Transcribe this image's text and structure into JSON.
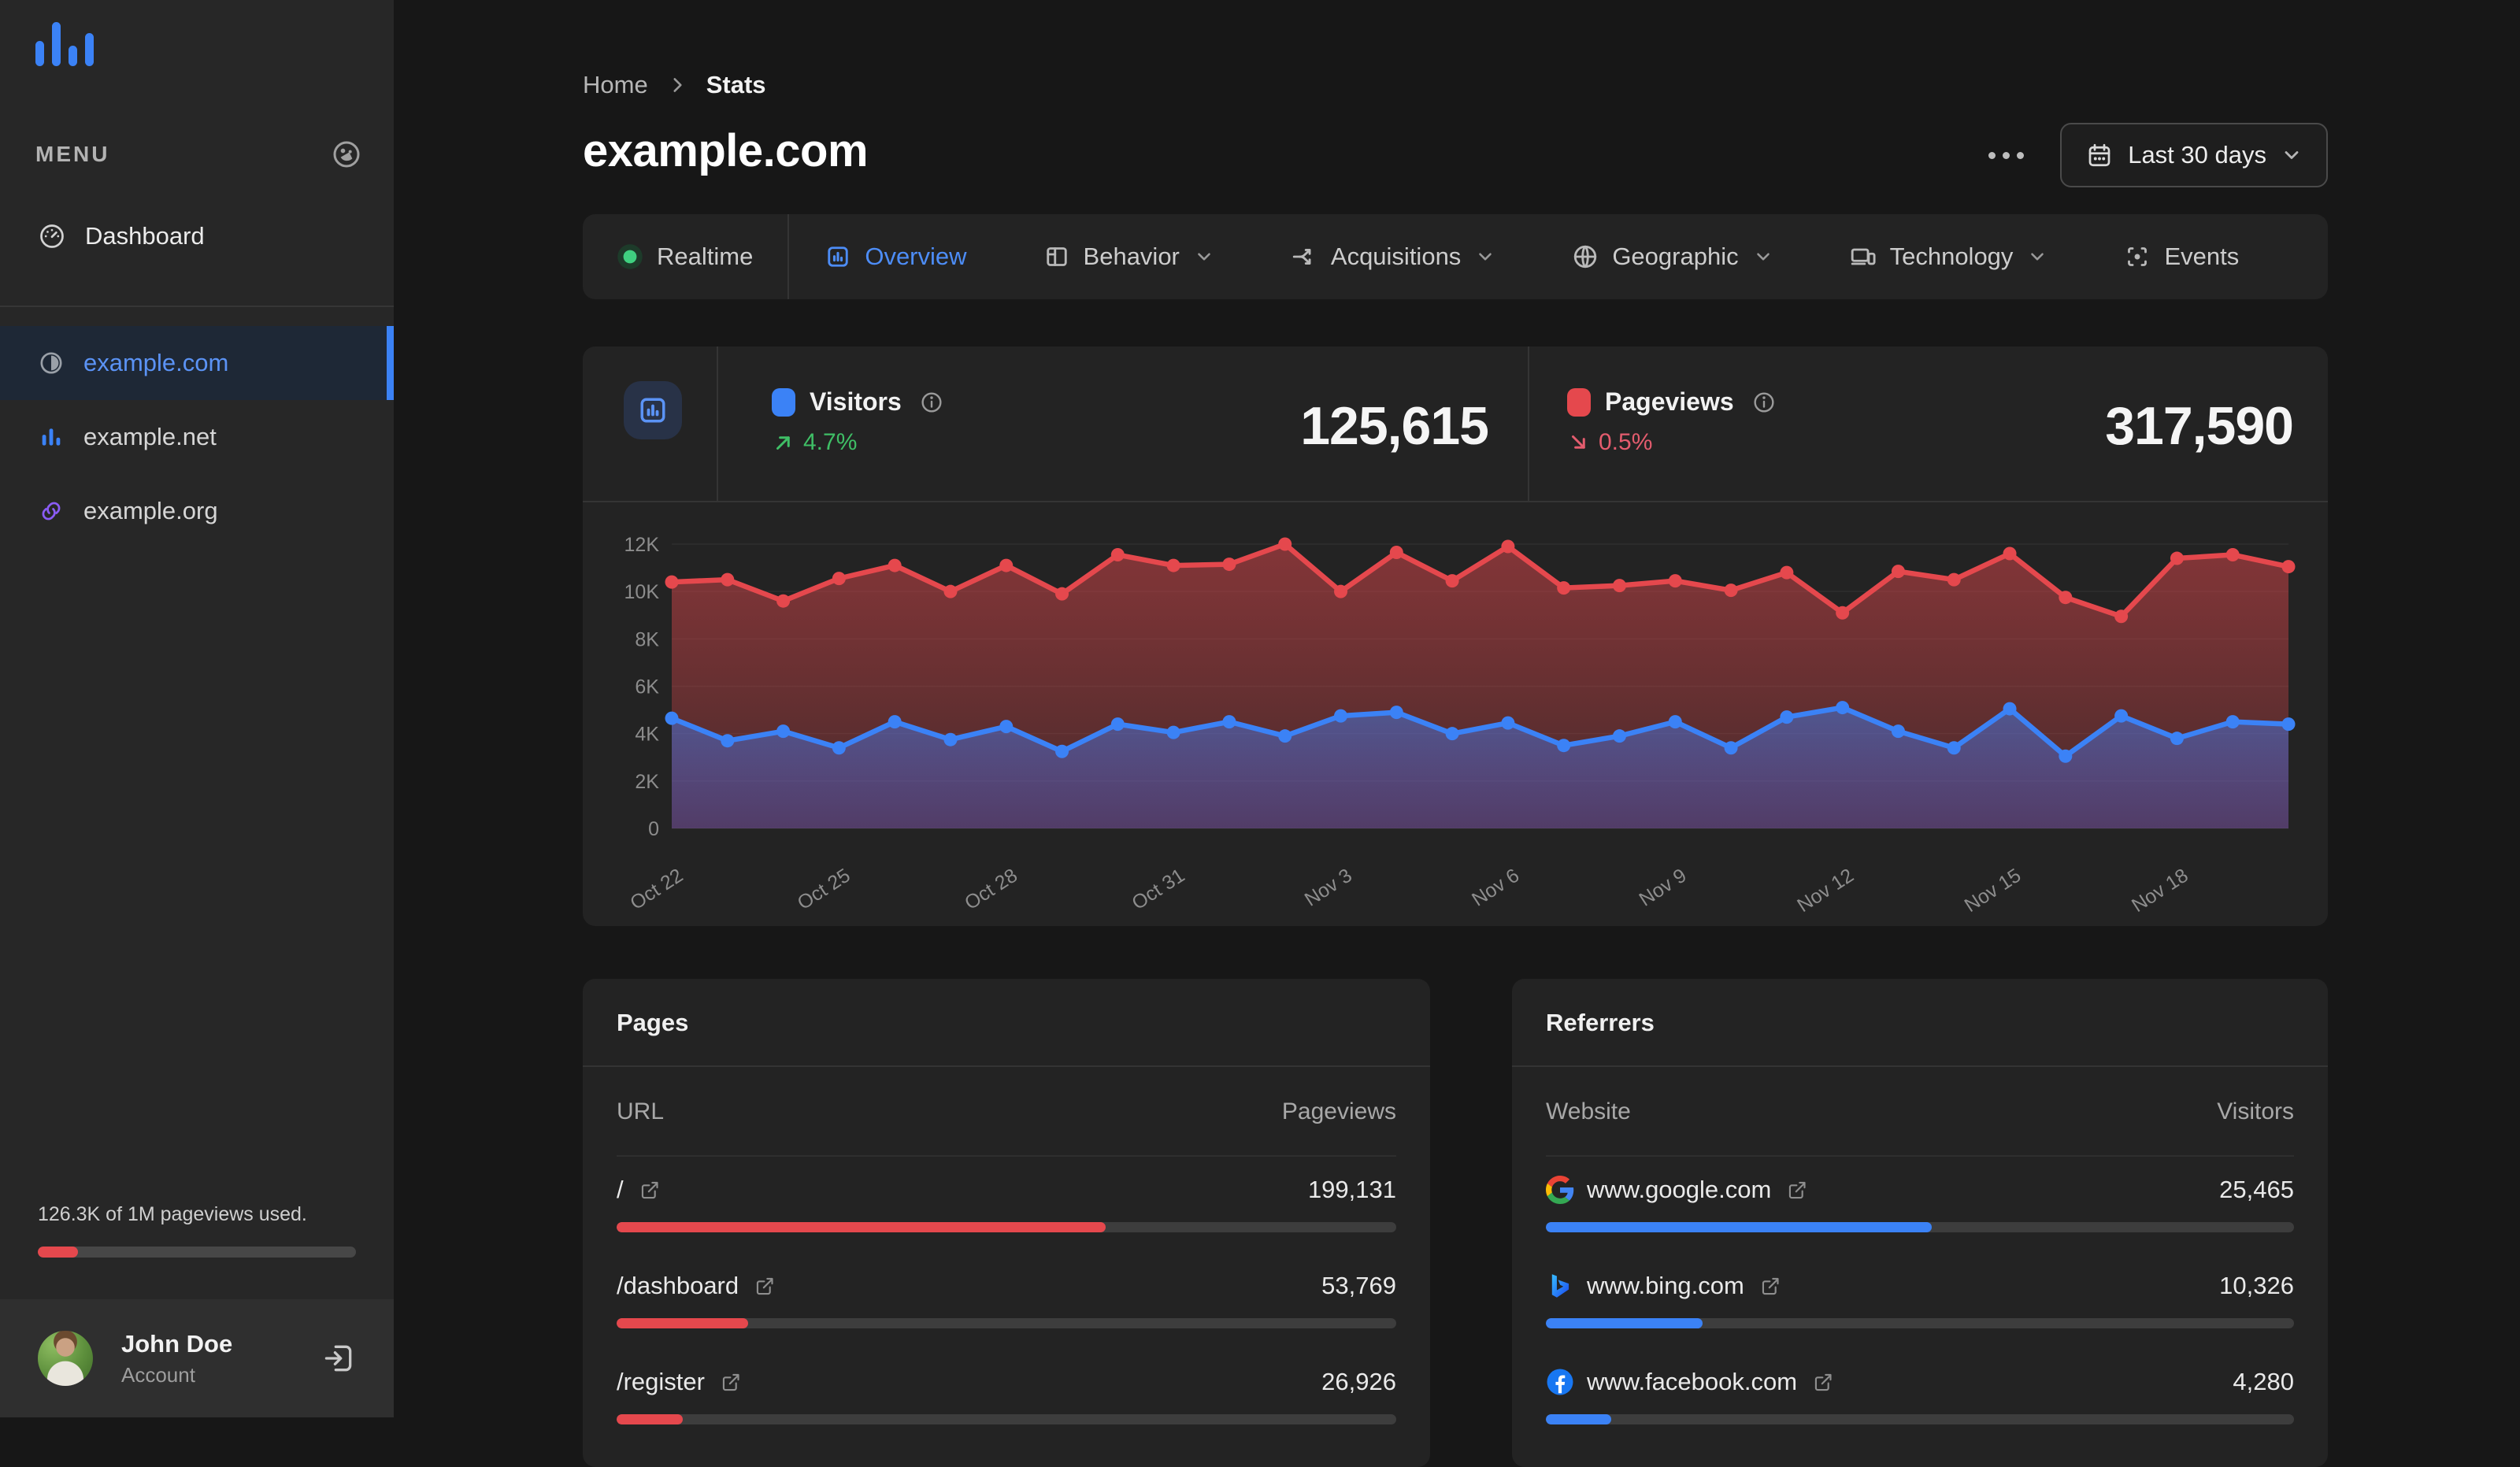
{
  "colors": {
    "accent_blue": "#3b82f6",
    "accent_red": "#e5484d",
    "accent_green": "#3fbf66",
    "accent_purple": "#8b5cf6",
    "sidebar_bg": "#272727",
    "card_bg": "#232323",
    "page_bg": "#171717"
  },
  "sidebar": {
    "logo_icon": "bar-chart-logo",
    "menu_label": "MENU",
    "theme_icon": "theme-icon",
    "nav": [
      {
        "icon": "gauge-icon",
        "label": "Dashboard"
      }
    ],
    "sites": [
      {
        "icon": "contrast-icon",
        "icon_color": "#9aa0a8",
        "label": "example.com",
        "active": true
      },
      {
        "icon": "bar-chart-icon",
        "icon_color": "#3b82f6",
        "label": "example.net",
        "active": false
      },
      {
        "icon": "link-icon",
        "icon_color": "#8b5cf6",
        "label": "example.org",
        "active": false
      }
    ],
    "usage": {
      "text": "126.3K of 1M pageviews used.",
      "percent": 12.6
    },
    "user": {
      "name": "John Doe",
      "subtitle": "Account",
      "logout_icon": "logout-icon"
    }
  },
  "header": {
    "breadcrumb": [
      "Home",
      "Stats"
    ],
    "title": "example.com",
    "date_range": "Last 30 days"
  },
  "tabs": [
    {
      "icon": "realtime-dot",
      "label": "Realtime",
      "active": false,
      "dropdown": false,
      "divider_after": true
    },
    {
      "icon": "overview-icon",
      "label": "Overview",
      "active": true,
      "dropdown": false
    },
    {
      "icon": "behavior-icon",
      "label": "Behavior",
      "active": false,
      "dropdown": true
    },
    {
      "icon": "acquisitions-icon",
      "label": "Acquisitions",
      "active": false,
      "dropdown": true
    },
    {
      "icon": "geographic-icon",
      "label": "Geographic",
      "active": false,
      "dropdown": true
    },
    {
      "icon": "technology-icon",
      "label": "Technology",
      "active": false,
      "dropdown": true
    },
    {
      "icon": "events-icon",
      "label": "Events",
      "active": false,
      "dropdown": false
    }
  ],
  "stats": [
    {
      "label": "Visitors",
      "value": "125,615",
      "delta": "4.7%",
      "trend": "up",
      "color": "#3b82f6"
    },
    {
      "label": "Pageviews",
      "value": "317,590",
      "delta": "0.5%",
      "trend": "down",
      "color": "#e5484d"
    }
  ],
  "chart_data": {
    "type": "line",
    "title": "Visitors and Pageviews over last 30 days",
    "x_labels_shown": [
      "Oct 22",
      "Oct 25",
      "Oct 28",
      "Oct 31",
      "Nov 3",
      "Nov 6",
      "Nov 9",
      "Nov 12",
      "Nov 15",
      "Nov 18"
    ],
    "label_every": 3,
    "ylim": [
      0,
      12000
    ],
    "yticks": [
      "0",
      "2K",
      "4K",
      "6K",
      "8K",
      "10K",
      "12K"
    ],
    "grid": true,
    "legend_position": "header",
    "series": [
      {
        "name": "Pageviews",
        "color": "#e5484d",
        "values": [
          10400,
          10500,
          9600,
          10550,
          11100,
          10000,
          11100,
          9900,
          11550,
          11100,
          11150,
          12000,
          10000,
          11650,
          10450,
          11900,
          10150,
          10250,
          10450,
          10050,
          10800,
          9100,
          10850,
          10500,
          11600,
          9750,
          8950,
          11400,
          11550,
          11050
        ]
      },
      {
        "name": "Visitors",
        "color": "#3b82f6",
        "values": [
          4650,
          3700,
          4100,
          3400,
          4500,
          3750,
          4300,
          3250,
          4400,
          4050,
          4500,
          3900,
          4750,
          4900,
          4000,
          4450,
          3500,
          3900,
          4500,
          3400,
          4700,
          5100,
          4100,
          3400,
          5050,
          3050,
          4750,
          3800,
          4500,
          4400
        ]
      }
    ]
  },
  "pages": {
    "title": "Pages",
    "columns": [
      "URL",
      "Pageviews"
    ],
    "bar_color": "#e5484d",
    "rows": [
      {
        "label": "/",
        "value": "199,131",
        "percent": 62.7
      },
      {
        "label": "/dashboard",
        "value": "53,769",
        "percent": 16.9
      },
      {
        "label": "/register",
        "value": "26,926",
        "percent": 8.5
      }
    ]
  },
  "referrers": {
    "title": "Referrers",
    "columns": [
      "Website",
      "Visitors"
    ],
    "bar_color": "#3b82f6",
    "rows": [
      {
        "icon": "google-favicon",
        "label": "www.google.com",
        "value": "25,465",
        "percent": 51.6
      },
      {
        "icon": "bing-favicon",
        "label": "www.bing.com",
        "value": "10,326",
        "percent": 20.9
      },
      {
        "icon": "facebook-favicon",
        "label": "www.facebook.com",
        "value": "4,280",
        "percent": 8.7
      }
    ]
  }
}
